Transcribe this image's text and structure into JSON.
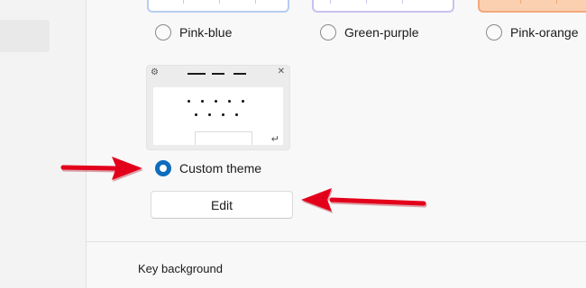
{
  "theme_options": [
    {
      "label": "Pink-blue",
      "selected": false
    },
    {
      "label": "Green-purple",
      "selected": false
    },
    {
      "label": "Pink-orange",
      "selected": false
    }
  ],
  "custom_theme": {
    "label": "Custom theme",
    "selected": true,
    "edit_label": "Edit"
  },
  "next_section": {
    "label": "Key background"
  },
  "colors": {
    "accent": "#0f6cbd",
    "annotation_arrow": "#e3001b"
  },
  "icons": {
    "settings": "gear-icon",
    "close": "close-icon",
    "enter": "enter-key-icon"
  }
}
